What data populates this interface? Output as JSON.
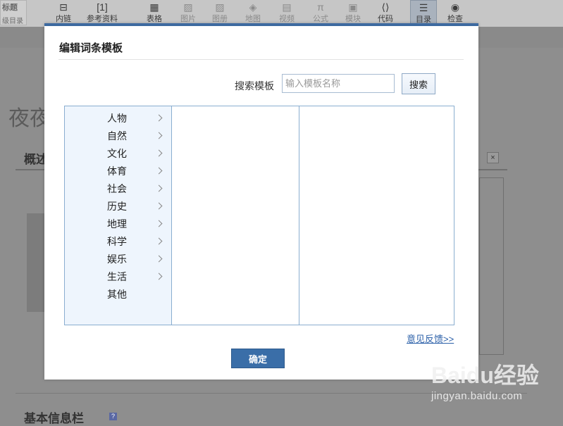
{
  "toolbar": {
    "left_tool": {
      "title": "标题",
      "subtitle": "级目录"
    },
    "buttons": [
      {
        "label": "内链",
        "icon": "link-icon",
        "glyph": "⊟",
        "enabled": true
      },
      {
        "label": "参考资料",
        "icon": "reference-icon",
        "glyph": "[1]",
        "enabled": true
      },
      {
        "label": "表格",
        "icon": "table-icon",
        "glyph": "▦",
        "enabled": true
      },
      {
        "label": "图片",
        "icon": "image-icon",
        "glyph": "▨",
        "enabled": false
      },
      {
        "label": "图册",
        "icon": "album-icon",
        "glyph": "▨",
        "enabled": false
      },
      {
        "label": "地图",
        "icon": "map-icon",
        "glyph": "◈",
        "enabled": false
      },
      {
        "label": "视频",
        "icon": "video-icon",
        "glyph": "▤",
        "enabled": false
      },
      {
        "label": "公式",
        "icon": "formula-icon",
        "glyph": "π",
        "enabled": false
      },
      {
        "label": "模块",
        "icon": "module-icon",
        "glyph": "▣",
        "enabled": false
      },
      {
        "label": "代码",
        "icon": "code-icon",
        "glyph": "⟨⟩",
        "enabled": true
      },
      {
        "label": "目录",
        "icon": "toc-icon",
        "glyph": "☰",
        "enabled": true,
        "active": true
      },
      {
        "label": "检查",
        "icon": "check-icon",
        "glyph": "◉",
        "enabled": true
      }
    ]
  },
  "background": {
    "article_title": "夜夜",
    "section_title": "概述",
    "section_close": "×",
    "basic_info_title": "基本信息栏",
    "help_glyph": "?"
  },
  "dialog": {
    "title": "编辑词条模板",
    "search_label": "搜索模板",
    "search_placeholder": "输入模板名称",
    "search_value": "",
    "search_button": "搜索",
    "categories": [
      {
        "label": "人物",
        "has_children": true
      },
      {
        "label": "自然",
        "has_children": true
      },
      {
        "label": "文化",
        "has_children": true
      },
      {
        "label": "体育",
        "has_children": true
      },
      {
        "label": "社会",
        "has_children": true
      },
      {
        "label": "历史",
        "has_children": true
      },
      {
        "label": "地理",
        "has_children": true
      },
      {
        "label": "科学",
        "has_children": true
      },
      {
        "label": "娱乐",
        "has_children": true
      },
      {
        "label": "生活",
        "has_children": true
      },
      {
        "label": "其他",
        "has_children": false
      }
    ],
    "feedback_link": "意见反馈>>",
    "confirm_button": "确定"
  },
  "watermark": {
    "brand": "Baidu经验",
    "url": "jingyan.baidu.com"
  },
  "colors": {
    "accent": "#3d6aa0",
    "confirm": "#3a6ea8",
    "link": "#2a5fa8",
    "category_bg": "#eef5fd",
    "panel_border": "#8aaed0"
  }
}
